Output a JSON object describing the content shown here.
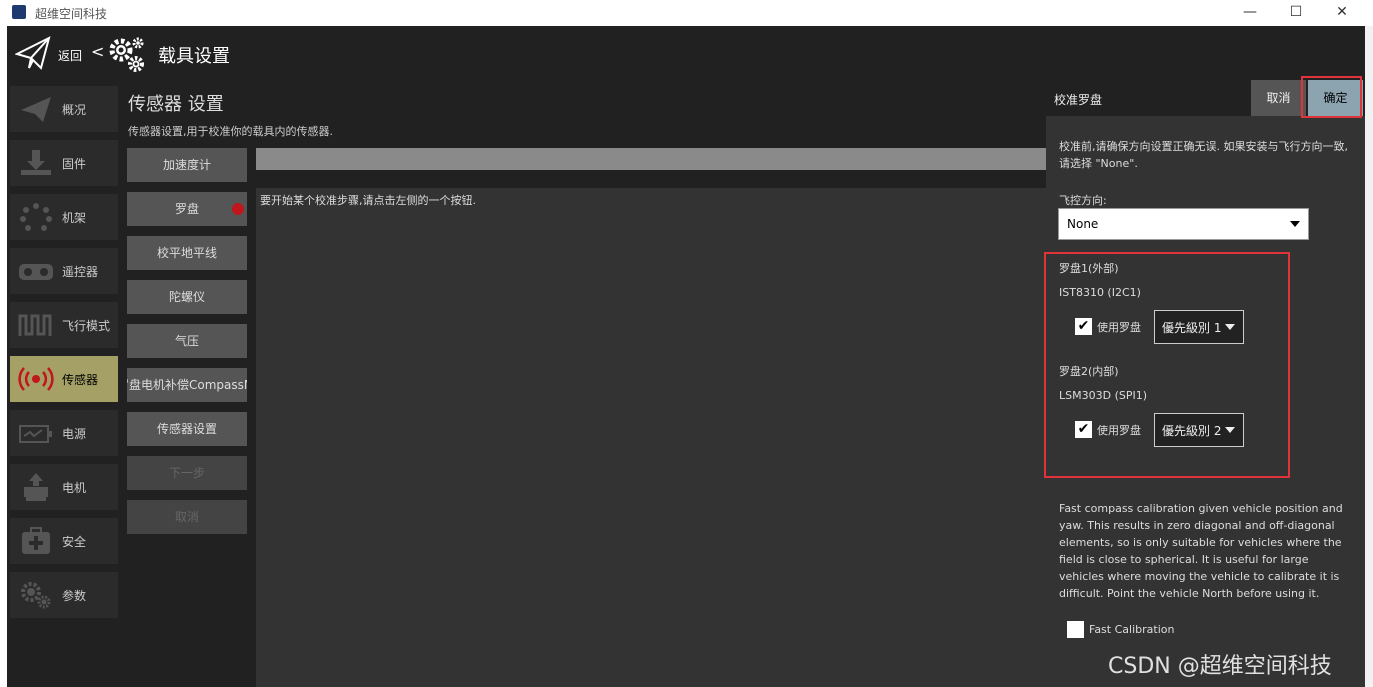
{
  "window": {
    "title": "超维空间科技",
    "minimize": "—",
    "maximize": "☐",
    "close": "✕"
  },
  "header": {
    "back_label": "返回",
    "separator": "<",
    "title": "载具设置"
  },
  "nav": {
    "items": [
      {
        "label": "概况",
        "icon": "plane-icon"
      },
      {
        "label": "固件",
        "icon": "download-icon"
      },
      {
        "label": "机架",
        "icon": "frame-icon"
      },
      {
        "label": "遥控器",
        "icon": "rc-icon"
      },
      {
        "label": "飞行模式",
        "icon": "wave-icon"
      },
      {
        "label": "传感器",
        "icon": "sensor-icon"
      },
      {
        "label": "电源",
        "icon": "battery-icon"
      },
      {
        "label": "电机",
        "icon": "motor-icon"
      },
      {
        "label": "安全",
        "icon": "medkit-icon"
      },
      {
        "label": "参数",
        "icon": "gears-icon"
      }
    ],
    "active_index": 5
  },
  "sensor": {
    "title": "传感器 设置",
    "description": "传感器设置,用于校准你的载具内的传感器.",
    "buttons": [
      {
        "label": "加速度计"
      },
      {
        "label": "罗盘"
      },
      {
        "label": "校平地平线"
      },
      {
        "label": "陀螺仪"
      },
      {
        "label": "气压"
      },
      {
        "label": "罗盘电机补偿CompassMot"
      },
      {
        "label": "传感器设置"
      },
      {
        "label": "下一步"
      },
      {
        "label": "取消"
      }
    ],
    "instruction": "要开始某个校准步骤,请点击左侧的一个按钮."
  },
  "compass_panel": {
    "title": "校准罗盘",
    "cancel_label": "取消",
    "ok_label": "确定",
    "intro": "校准前,请确保方向设置正确无误. 如果安装与飞行方向一致, 请选择 \"None\".",
    "orientation_label": "飞控方向:",
    "orientation_value": "None",
    "compass1": {
      "header": "罗盘1(外部)",
      "device": "IST8310 (I2C1)",
      "use_label": "使用罗盘",
      "checked": true,
      "priority": "優先級別 1"
    },
    "compass2": {
      "header": "罗盘2(内部)",
      "device": "LSM303D (SPI1)",
      "use_label": "使用罗盘",
      "checked": true,
      "priority": "優先級別 2"
    },
    "fast_description": "Fast compass calibration given vehicle position and yaw. This results in zero diagonal and off-diagonal elements, so is only suitable for vehicles where the field is close to spherical. It is useful for large vehicles where moving the vehicle to calibrate it is difficult. Point the vehicle North before using it.",
    "fast_label": "Fast Calibration",
    "fast_checked": false
  },
  "watermark": "CSDN @超维空间科技",
  "colors": {
    "background": "#212121",
    "active_nav": "#a5a066",
    "ok_button": "#8ca3b0",
    "highlight": "#e0333a",
    "status_dot": "#c0161c"
  }
}
